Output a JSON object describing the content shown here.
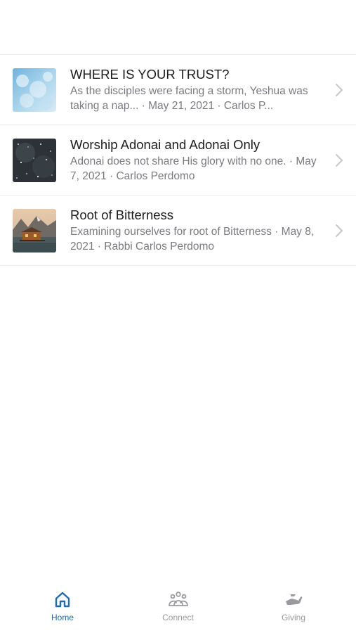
{
  "accent_color": "#1f6db0",
  "inactive_color": "#9a9a9e",
  "messages": [
    {
      "title": "WHERE IS YOUR TRUST?",
      "subtitle": "As the disciples were facing a storm, Yeshua was taking a nap... · May 21, 2021 · Carlos P...",
      "thumbnail": "light-blue-sky-image"
    },
    {
      "title": "Worship Adonai and Adonai Only",
      "subtitle": "Adonai does not share His glory with no one. · May 7, 2021 · Carlos Perdomo",
      "thumbnail": "dark-starry-sky-image"
    },
    {
      "title": "Root of Bitterness",
      "subtitle": "Examining ourselves for root of Bitterness · May 8, 2021 · Rabbi Carlos Perdomo",
      "thumbnail": "lake-cabin-image"
    }
  ],
  "tabbar": {
    "tabs": [
      {
        "label": "Home",
        "icon": "home-icon",
        "active": true
      },
      {
        "label": "Connect",
        "icon": "people-icon",
        "active": false
      },
      {
        "label": "Giving",
        "icon": "giving-hand-icon",
        "active": false
      }
    ]
  }
}
